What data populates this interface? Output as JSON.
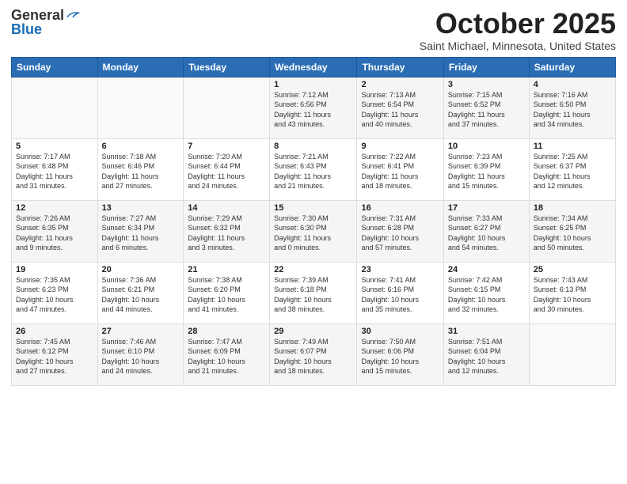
{
  "header": {
    "logo_general": "General",
    "logo_blue": "Blue",
    "month_title": "October 2025",
    "location": "Saint Michael, Minnesota, United States"
  },
  "days_of_week": [
    "Sunday",
    "Monday",
    "Tuesday",
    "Wednesday",
    "Thursday",
    "Friday",
    "Saturday"
  ],
  "weeks": [
    [
      {
        "day": "",
        "info": ""
      },
      {
        "day": "",
        "info": ""
      },
      {
        "day": "",
        "info": ""
      },
      {
        "day": "1",
        "info": "Sunrise: 7:12 AM\nSunset: 6:56 PM\nDaylight: 11 hours\nand 43 minutes."
      },
      {
        "day": "2",
        "info": "Sunrise: 7:13 AM\nSunset: 6:54 PM\nDaylight: 11 hours\nand 40 minutes."
      },
      {
        "day": "3",
        "info": "Sunrise: 7:15 AM\nSunset: 6:52 PM\nDaylight: 11 hours\nand 37 minutes."
      },
      {
        "day": "4",
        "info": "Sunrise: 7:16 AM\nSunset: 6:50 PM\nDaylight: 11 hours\nand 34 minutes."
      }
    ],
    [
      {
        "day": "5",
        "info": "Sunrise: 7:17 AM\nSunset: 6:48 PM\nDaylight: 11 hours\nand 31 minutes."
      },
      {
        "day": "6",
        "info": "Sunrise: 7:18 AM\nSunset: 6:46 PM\nDaylight: 11 hours\nand 27 minutes."
      },
      {
        "day": "7",
        "info": "Sunrise: 7:20 AM\nSunset: 6:44 PM\nDaylight: 11 hours\nand 24 minutes."
      },
      {
        "day": "8",
        "info": "Sunrise: 7:21 AM\nSunset: 6:43 PM\nDaylight: 11 hours\nand 21 minutes."
      },
      {
        "day": "9",
        "info": "Sunrise: 7:22 AM\nSunset: 6:41 PM\nDaylight: 11 hours\nand 18 minutes."
      },
      {
        "day": "10",
        "info": "Sunrise: 7:23 AM\nSunset: 6:39 PM\nDaylight: 11 hours\nand 15 minutes."
      },
      {
        "day": "11",
        "info": "Sunrise: 7:25 AM\nSunset: 6:37 PM\nDaylight: 11 hours\nand 12 minutes."
      }
    ],
    [
      {
        "day": "12",
        "info": "Sunrise: 7:26 AM\nSunset: 6:35 PM\nDaylight: 11 hours\nand 9 minutes."
      },
      {
        "day": "13",
        "info": "Sunrise: 7:27 AM\nSunset: 6:34 PM\nDaylight: 11 hours\nand 6 minutes."
      },
      {
        "day": "14",
        "info": "Sunrise: 7:29 AM\nSunset: 6:32 PM\nDaylight: 11 hours\nand 3 minutes."
      },
      {
        "day": "15",
        "info": "Sunrise: 7:30 AM\nSunset: 6:30 PM\nDaylight: 11 hours\nand 0 minutes."
      },
      {
        "day": "16",
        "info": "Sunrise: 7:31 AM\nSunset: 6:28 PM\nDaylight: 10 hours\nand 57 minutes."
      },
      {
        "day": "17",
        "info": "Sunrise: 7:33 AM\nSunset: 6:27 PM\nDaylight: 10 hours\nand 54 minutes."
      },
      {
        "day": "18",
        "info": "Sunrise: 7:34 AM\nSunset: 6:25 PM\nDaylight: 10 hours\nand 50 minutes."
      }
    ],
    [
      {
        "day": "19",
        "info": "Sunrise: 7:35 AM\nSunset: 6:23 PM\nDaylight: 10 hours\nand 47 minutes."
      },
      {
        "day": "20",
        "info": "Sunrise: 7:36 AM\nSunset: 6:21 PM\nDaylight: 10 hours\nand 44 minutes."
      },
      {
        "day": "21",
        "info": "Sunrise: 7:38 AM\nSunset: 6:20 PM\nDaylight: 10 hours\nand 41 minutes."
      },
      {
        "day": "22",
        "info": "Sunrise: 7:39 AM\nSunset: 6:18 PM\nDaylight: 10 hours\nand 38 minutes."
      },
      {
        "day": "23",
        "info": "Sunrise: 7:41 AM\nSunset: 6:16 PM\nDaylight: 10 hours\nand 35 minutes."
      },
      {
        "day": "24",
        "info": "Sunrise: 7:42 AM\nSunset: 6:15 PM\nDaylight: 10 hours\nand 32 minutes."
      },
      {
        "day": "25",
        "info": "Sunrise: 7:43 AM\nSunset: 6:13 PM\nDaylight: 10 hours\nand 30 minutes."
      }
    ],
    [
      {
        "day": "26",
        "info": "Sunrise: 7:45 AM\nSunset: 6:12 PM\nDaylight: 10 hours\nand 27 minutes."
      },
      {
        "day": "27",
        "info": "Sunrise: 7:46 AM\nSunset: 6:10 PM\nDaylight: 10 hours\nand 24 minutes."
      },
      {
        "day": "28",
        "info": "Sunrise: 7:47 AM\nSunset: 6:09 PM\nDaylight: 10 hours\nand 21 minutes."
      },
      {
        "day": "29",
        "info": "Sunrise: 7:49 AM\nSunset: 6:07 PM\nDaylight: 10 hours\nand 18 minutes."
      },
      {
        "day": "30",
        "info": "Sunrise: 7:50 AM\nSunset: 6:06 PM\nDaylight: 10 hours\nand 15 minutes."
      },
      {
        "day": "31",
        "info": "Sunrise: 7:51 AM\nSunset: 6:04 PM\nDaylight: 10 hours\nand 12 minutes."
      },
      {
        "day": "",
        "info": ""
      }
    ]
  ]
}
